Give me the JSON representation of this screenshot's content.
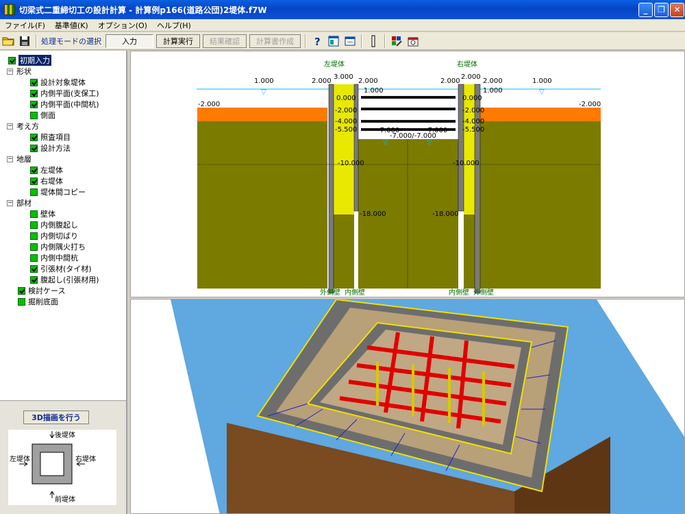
{
  "window": {
    "title": "切梁式二重締切工の設計計算 - 計算例p166(道路公団)2堤体.f7W",
    "min_label": "_",
    "max_label": "❐",
    "close_label": "✕"
  },
  "menu": [
    "ファイル(F)",
    "基準値(K)",
    "オプション(O)",
    "ヘルプ(H)"
  ],
  "toolbar": {
    "mode_label": "処理モードの選択",
    "buttons": [
      {
        "label": "入力",
        "state": "pressed"
      },
      {
        "label": "計算実行",
        "state": "normal"
      },
      {
        "label": "結果確認",
        "state": "disabled"
      },
      {
        "label": "計算書作成",
        "state": "disabled"
      }
    ]
  },
  "tree": {
    "root": "初期入力",
    "groups": [
      {
        "label": "形状",
        "items": [
          "設計対象堤体",
          "内側平面(支保工)",
          "内側平面(中間杭)",
          "側面"
        ]
      },
      {
        "label": "考え方",
        "items": [
          "照査項目",
          "設計方法"
        ]
      },
      {
        "label": "地層",
        "items": [
          "左堤体",
          "右堤体",
          "堤体間コピー"
        ]
      },
      {
        "label": "部材",
        "items": [
          "壁体",
          "内側腹起し",
          "内側切ばり",
          "内側隅火打ち",
          "内側中間杭",
          "引張材(タイ材)",
          "腹起し(引張材用)"
        ]
      }
    ],
    "tail": [
      "検討ケース",
      "掘削底面"
    ]
  },
  "draw3d": {
    "button": "3D描画を行う",
    "rear": "後堤体",
    "left": "左堤体",
    "right": "右堤体",
    "front": "前堤体"
  },
  "section": {
    "left_title": "左堤体",
    "right_title": "右堤体",
    "dims": {
      "a": "1.000",
      "b": "2.000",
      "c": "3.000",
      "d": "2.000",
      "e": "2.000",
      "f": "2.000",
      "g": "2.000",
      "h": "1.000"
    },
    "levels_left": [
      "1.000",
      "0.000",
      "-2.000",
      "-4.000",
      "-5.500",
      "-10.000",
      "-18.000"
    ],
    "levels_right": [
      "1.000",
      "0.000",
      "-2.000",
      "-4.000",
      "-5.500",
      "-10.000",
      "-18.000"
    ],
    "ground_left": "-2.000",
    "ground_right": "-2.000",
    "excav_left": "-7.000",
    "excav_right": "-7.000",
    "excav_mid": "-7.000/-7.000",
    "bottom_left": "外側壁",
    "bottom_left2": "内側壁",
    "bottom_right": "内側壁",
    "bottom_right2": "外側壁",
    "colors": {
      "soil": "#7b7b00",
      "top_layer": "#ff7b00",
      "wall_fill": "#e8e800",
      "wall": "#7a7a7a",
      "water": "#00bfff"
    }
  }
}
